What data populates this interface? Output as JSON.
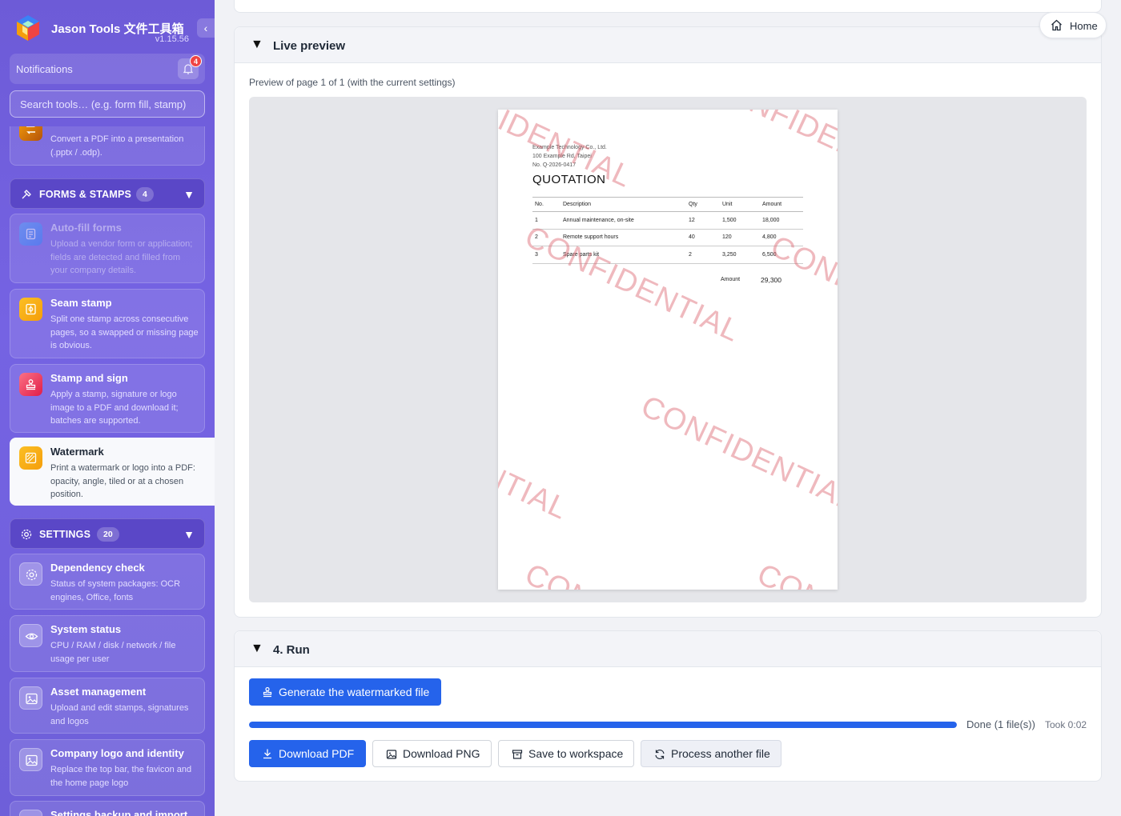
{
  "brand": {
    "title": "Jason Tools 文件工具箱",
    "version": "v1.15.56",
    "collapse": "‹"
  },
  "notifications": {
    "label": "Notifications",
    "count": "4"
  },
  "search": {
    "placeholder": "Search tools… (e.g. form fill, stamp)"
  },
  "sidebar": {
    "partial_card": {
      "desc": "Convert a PDF into a presentation (.pptx / .odp)."
    },
    "forms_section": {
      "label": "FORMS & STAMPS",
      "count": "4",
      "arrow": "▼"
    },
    "forms_items": [
      {
        "title": "Auto-fill forms",
        "desc": "Upload a vendor form or application; fields are detected and filled from your company details."
      },
      {
        "title": "Seam stamp",
        "desc": "Split one stamp across consecutive pages, so a swapped or missing page is obvious."
      },
      {
        "title": "Stamp and sign",
        "desc": "Apply a stamp, signature or logo image to a PDF and download it; batches are supported."
      },
      {
        "title": "Watermark",
        "desc": "Print a watermark or logo into a PDF: opacity, angle, tiled or at a chosen position."
      }
    ],
    "settings_section": {
      "label": "SETTINGS",
      "count": "20",
      "arrow": "▼"
    },
    "settings_items": [
      {
        "title": "Dependency check",
        "desc": "Status of system packages: OCR engines, Office, fonts"
      },
      {
        "title": "System status",
        "desc": "CPU / RAM / disk / network / file usage per user"
      },
      {
        "title": "Asset management",
        "desc": "Upload and edit stamps, signatures and logos"
      },
      {
        "title": "Company logo and identity",
        "desc": "Replace the top bar, the favicon and the home page logo"
      },
      {
        "title": "Settings backup and import",
        "desc": ""
      }
    ]
  },
  "home": {
    "label": "Home"
  },
  "preview": {
    "arrow": "▼",
    "title": "Live preview",
    "caption": "Preview of page 1 of 1 (with the current settings)",
    "doc": {
      "company_lines": [
        "Example Technology Co., Ltd.",
        "100 Example Rd, Taipei",
        "No. Q-2026-0417"
      ],
      "title": "QUOTATION",
      "headers": [
        "No.",
        "Description",
        "Qty",
        "Unit",
        "Amount"
      ],
      "rows": [
        [
          "1",
          "Annual maintenance, on-site",
          "12",
          "1,500",
          "18,000"
        ],
        [
          "2",
          "Remote support hours",
          "40",
          "120",
          "4,800"
        ],
        [
          "3",
          "Spare parts kit",
          "2",
          "3,250",
          "6,500"
        ]
      ],
      "total_label": "Amount",
      "total_value": "29,300",
      "watermark": "CONFIDENTIAL"
    }
  },
  "run": {
    "arrow": "▼",
    "title": "4. Run",
    "generate_label": "Generate the watermarked file",
    "progress_fraction": 1.0,
    "status": "Done (1 file(s))",
    "took": "Took 0:02",
    "download_pdf": "Download PDF",
    "download_png": "Download PNG",
    "save_workspace": "Save to workspace",
    "process_another": "Process another file"
  }
}
